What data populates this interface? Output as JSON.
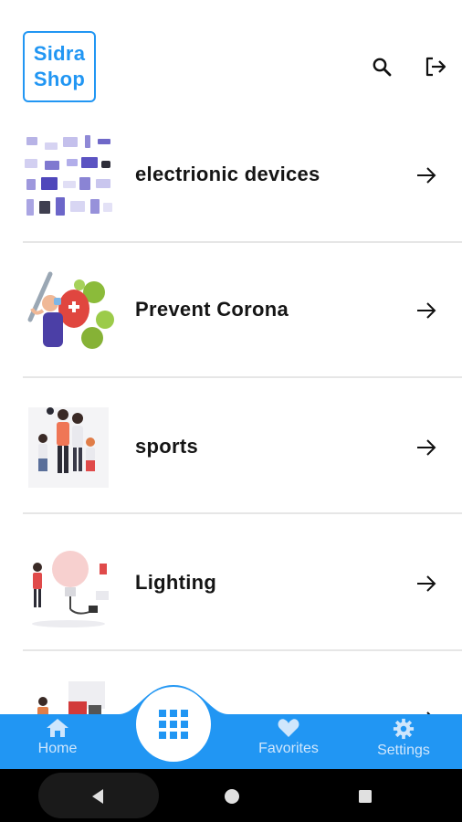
{
  "header": {
    "logo_line1": "Sidra",
    "logo_line2": "Shop",
    "brand_color": "#2196f3",
    "icons": [
      "search-icon",
      "logout-icon"
    ]
  },
  "categories": [
    {
      "label": "electrionic devices",
      "thumb": "electronic-devices-illustration"
    },
    {
      "label": "Prevent Corona",
      "thumb": "prevent-corona-illustration"
    },
    {
      "label": "sports",
      "thumb": "sports-family-illustration"
    },
    {
      "label": "Lighting",
      "thumb": "lighting-bulb-illustration"
    },
    {
      "label": "",
      "thumb": "partially-visible-category-illustration"
    }
  ],
  "bottom_nav": {
    "items": [
      {
        "label": "Home",
        "icon": "home-icon"
      },
      {
        "label": "Favorites",
        "icon": "heart-icon"
      },
      {
        "label": "Settings",
        "icon": "gear-icon"
      }
    ],
    "center_icon": "grid-icon",
    "bar_color": "#2196f3"
  },
  "system_nav": {
    "icons": [
      "back-icon",
      "home-circle-icon",
      "recents-square-icon"
    ]
  }
}
